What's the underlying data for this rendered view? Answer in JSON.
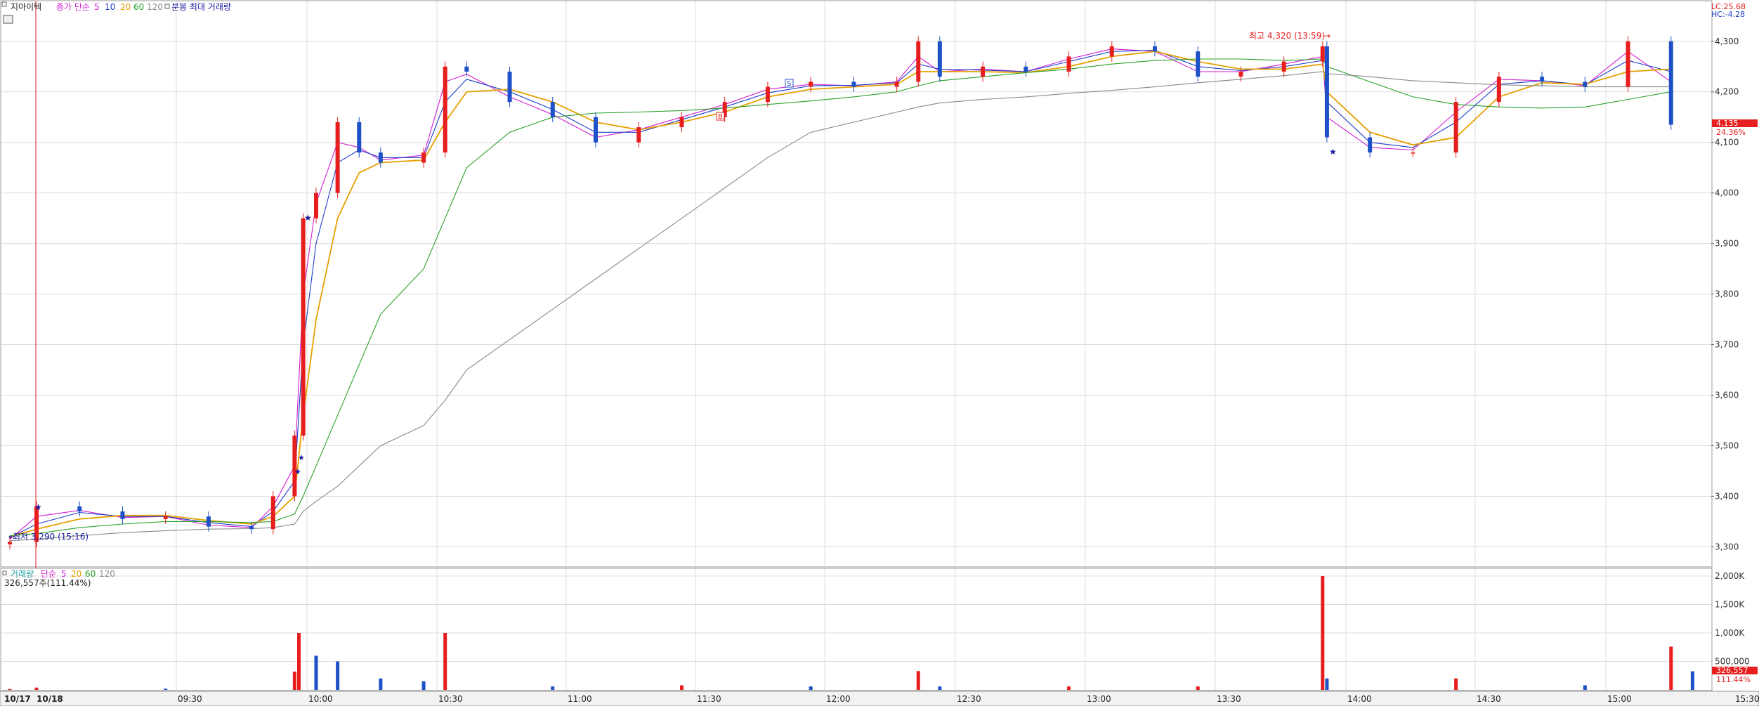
{
  "header": {
    "stock_name": "지아이텍",
    "ma_label": "종가 단순",
    "ma_periods": [
      "5",
      "10",
      "20",
      "60",
      "120"
    ],
    "ma_colors": [
      "#d21ed2",
      "#1e3cc8",
      "#e6a000",
      "#28a028",
      "#888888"
    ],
    "extra_label": "분봉 최대 거래량",
    "lc_text": "LC:25.68",
    "hc_text": "HC:-4.28"
  },
  "volume_header": {
    "label": "거래량",
    "ma_label": "단순",
    "ma_periods": [
      "5",
      "20",
      "60",
      "120"
    ],
    "ma_colors": [
      "#d21ed2",
      "#e6a000",
      "#28a028",
      "#888888"
    ],
    "value_text": "326,557주(111.44%)"
  },
  "annotations": {
    "low_text": "최저 3,290 (15:16)",
    "high_text": "최고 4,320 (13:59)",
    "markers": [
      "S",
      "B"
    ]
  },
  "price_axis": {
    "ticks": [
      "4,300",
      "4,200",
      "4,100",
      "4,000",
      "3,900",
      "3,800",
      "3,700",
      "3,600",
      "3,500",
      "3,400",
      "3,300"
    ],
    "current_price": "4,135",
    "current_pct": "24.36%"
  },
  "volume_axis": {
    "ticks": [
      "2,000K",
      "1,500K",
      "1,000K",
      "500,000"
    ],
    "current_volume": "326,557",
    "current_pct": "111.44%"
  },
  "time_axis": {
    "ticks": [
      "10/17",
      "10/18",
      "09:30",
      "10:00",
      "10:30",
      "11:00",
      "11:30",
      "12:00",
      "12:30",
      "13:00",
      "13:30",
      "14:00",
      "14:30",
      "15:00",
      "15:30:00"
    ]
  },
  "colors": {
    "up": "#e61e1e",
    "down": "#1e50c8",
    "grid": "#dcdcdc",
    "axis_text": "#333333",
    "accent_red": "#e61e1e",
    "marker_blue": "#1414a0"
  },
  "chart_data": [
    {
      "type": "candlestick",
      "title": "지아이텍",
      "interval": "1-minute",
      "ylim": [
        3270,
        4340
      ],
      "x": [
        "10/17 15:10",
        "10/18 09:00",
        "09:10",
        "09:20",
        "09:30",
        "09:40",
        "09:50",
        "09:55",
        "10:00",
        "10:02",
        "10:05",
        "10:10",
        "10:15",
        "10:20",
        "10:30",
        "10:35",
        "10:40",
        "10:50",
        "11:00",
        "11:10",
        "11:20",
        "11:30",
        "11:40",
        "11:50",
        "12:00",
        "12:10",
        "12:20",
        "12:25",
        "12:30",
        "12:40",
        "12:50",
        "13:00",
        "13:10",
        "13:20",
        "13:30",
        "13:40",
        "13:50",
        "13:59",
        "14:00",
        "14:10",
        "14:20",
        "14:30",
        "14:40",
        "14:50",
        "15:00",
        "15:10",
        "15:20"
      ],
      "close": [
        3310,
        3380,
        3370,
        3355,
        3360,
        3340,
        3335,
        3400,
        3520,
        3950,
        4000,
        4140,
        4080,
        4060,
        4080,
        4250,
        4240,
        4180,
        4150,
        4100,
        4130,
        4150,
        4180,
        4210,
        4220,
        4210,
        4220,
        4300,
        4230,
        4250,
        4240,
        4270,
        4290,
        4280,
        4230,
        4240,
        4260,
        4290,
        4110,
        4080,
        4080,
        4180,
        4230,
        4220,
        4210,
        4300,
        4135
      ],
      "series": [
        {
          "name": "5",
          "values": [
            3315,
            3360,
            3372,
            3358,
            3360,
            3343,
            3338,
            3380,
            3460,
            3800,
            3980,
            4100,
            4090,
            4065,
            4075,
            4220,
            4235,
            4190,
            4155,
            4110,
            4125,
            4150,
            4175,
            4205,
            4215,
            4212,
            4220,
            4270,
            4240,
            4245,
            4240,
            4265,
            4285,
            4280,
            4240,
            4240,
            4255,
            4270,
            4150,
            4090,
            4085,
            4160,
            4225,
            4222,
            4212,
            4280,
            4220
          ]
        },
        {
          "name": "10",
          "values": [
            3318,
            3345,
            3368,
            3360,
            3360,
            3348,
            3340,
            3370,
            3430,
            3700,
            3900,
            4060,
            4085,
            4070,
            4070,
            4180,
            4225,
            4200,
            4165,
            4120,
            4120,
            4145,
            4170,
            4198,
            4212,
            4213,
            4218,
            4255,
            4245,
            4243,
            4240,
            4260,
            4280,
            4282,
            4250,
            4242,
            4250,
            4262,
            4180,
            4100,
            4090,
            4140,
            4215,
            4222,
            4214,
            4262,
            4240
          ]
        },
        {
          "name": "20",
          "values": [
            3320,
            3335,
            3355,
            3362,
            3362,
            3352,
            3345,
            3360,
            3400,
            3560,
            3750,
            3950,
            4040,
            4060,
            4065,
            4140,
            4200,
            4205,
            4180,
            4140,
            4125,
            4140,
            4160,
            4190,
            4205,
            4210,
            4215,
            4240,
            4240,
            4240,
            4238,
            4250,
            4270,
            4280,
            4260,
            4245,
            4245,
            4255,
            4200,
            4120,
            4095,
            4110,
            4190,
            4218,
            4215,
            4240,
            4245
          ]
        },
        {
          "name": "60",
          "values": [
            3322,
            3326,
            3338,
            3345,
            3350,
            3350,
            3348,
            3350,
            3365,
            3400,
            3460,
            3560,
            3660,
            3760,
            3850,
            3950,
            4050,
            4120,
            4150,
            4158,
            4160,
            4163,
            4168,
            4175,
            4182,
            4190,
            4200,
            4212,
            4222,
            4230,
            4238,
            4245,
            4255,
            4262,
            4265,
            4265,
            4262,
            4265,
            4250,
            4220,
            4190,
            4175,
            4170,
            4168,
            4170,
            4185,
            4200
          ]
        },
        {
          "name": "120",
          "values": [
            3312,
            3315,
            3322,
            3328,
            3332,
            3335,
            3336,
            3338,
            3345,
            3370,
            3390,
            3420,
            3460,
            3500,
            3540,
            3590,
            3650,
            3710,
            3770,
            3830,
            3890,
            3950,
            4010,
            4070,
            4120,
            4140,
            4160,
            4170,
            4178,
            4185,
            4190,
            4197,
            4203,
            4210,
            4218,
            4225,
            4232,
            4240,
            4236,
            4230,
            4222,
            4218,
            4214,
            4212,
            4210,
            4210,
            4210
          ]
        }
      ]
    },
    {
      "type": "bar",
      "title": "거래량",
      "x": [
        "10/17 15:10",
        "10/18 09:00",
        "09:30",
        "10:00",
        "10:01",
        "10:05",
        "10:10",
        "10:20",
        "10:30",
        "10:35",
        "11:00",
        "11:30",
        "12:00",
        "12:25",
        "12:30",
        "13:00",
        "13:30",
        "13:59",
        "14:00",
        "14:30",
        "15:00",
        "15:20",
        "15:25"
      ],
      "values": [
        15000,
        40000,
        20000,
        320000,
        1000000,
        600000,
        500000,
        200000,
        150000,
        1000000,
        60000,
        80000,
        60000,
        330000,
        60000,
        60000,
        60000,
        2000000,
        200000,
        200000,
        80000,
        760000,
        326557
      ],
      "ylim": [
        0,
        2050000
      ]
    }
  ]
}
